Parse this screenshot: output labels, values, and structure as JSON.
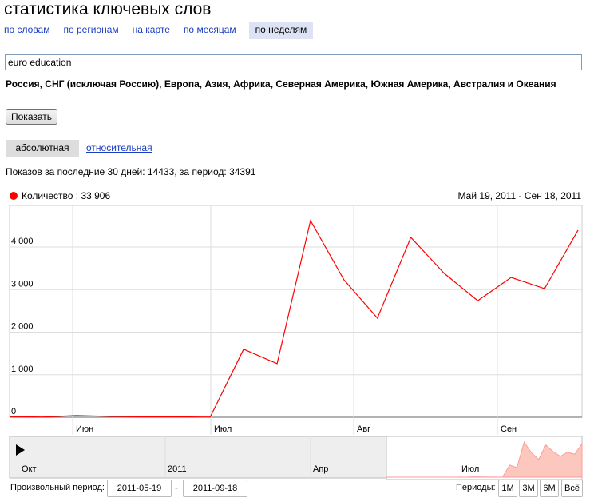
{
  "title": "статистика ключевых слов",
  "tabs": [
    {
      "label": "по словам"
    },
    {
      "label": "по регионам"
    },
    {
      "label": "на карте"
    },
    {
      "label": "по месяцам"
    },
    {
      "label": "по неделям"
    }
  ],
  "query": "euro education",
  "regions": "Россия, СНГ (исключая Россию), Европа, Азия, Африка, Северная Америка, Южная Америка, Австралия и Океания",
  "show_button": "Показать",
  "modes": {
    "absolute": "абсолютная",
    "relative": "относительная"
  },
  "stats": "Показов за последние 30 дней: 14433, за период: 34391",
  "colors": {
    "series": "#ff0000",
    "navigator_fill": "#fcc8bd"
  },
  "chart_data": {
    "type": "line",
    "legend": "Количество : 33 906",
    "range_label": "Май 19, 2011 - Сен 18, 2011",
    "y_ticks": [
      "0",
      "1 000",
      "2 000",
      "3 000",
      "4 000"
    ],
    "ylim": [
      0,
      4900
    ],
    "x_ticks": [
      "Июн",
      "Июл",
      "Авг",
      "Сен"
    ],
    "series": [
      {
        "name": "Количество",
        "values": [
          15,
          5,
          40,
          20,
          10,
          10,
          5,
          1600,
          1260,
          4620,
          3230,
          2330,
          4225,
          3380,
          2740,
          3286,
          3023,
          4395
        ]
      }
    ],
    "navigator_ticks": [
      "Окт",
      "2011",
      "Апр",
      "Июл"
    ]
  },
  "footer": {
    "custom_label": "Произвольный период:",
    "from": "2011-05-19",
    "dash": "-",
    "to": "2011-09-18",
    "periods_label": "Периоды:",
    "periods": [
      "1M",
      "3M",
      "6M",
      "Всё"
    ]
  }
}
